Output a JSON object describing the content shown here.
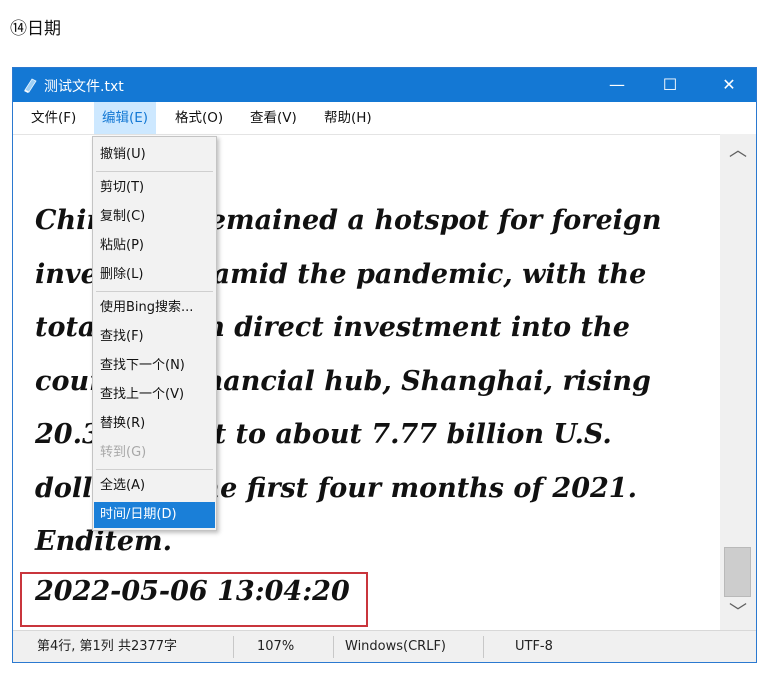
{
  "caption": "⑭日期",
  "window": {
    "title": "测试文件.txt",
    "controls": {
      "minimize": "—",
      "maximize": "☐",
      "close": "✕"
    }
  },
  "menubar": {
    "items": [
      {
        "label": "文件(F)"
      },
      {
        "label": "编辑(E)",
        "active": true
      },
      {
        "label": "格式(O)"
      },
      {
        "label": "查看(V)"
      },
      {
        "label": "帮助(H)"
      }
    ]
  },
  "edit_menu": {
    "undo": "撤销(U)",
    "cut": "剪切(T)",
    "copy": "复制(C)",
    "paste": "粘贴(P)",
    "delete": "删除(L)",
    "bing_search": "使用Bing搜索...",
    "find": "查找(F)",
    "find_next": "查找下一个(N)",
    "find_prev": "查找上一个(V)",
    "replace": "替换(R)",
    "goto": "转到(G)",
    "select_all": "全选(A)",
    "time_date": "时间/日期(D)"
  },
  "editor": {
    "lines": [
      "China has remained a hotspot for foreign",
      "investment amid the pandemic, with the",
      "total foreign direct investment into the",
      "country's financial hub, Shanghai, rising",
      "20.3 percent to about 7.77 billion U.S.",
      "dollars in the first four months of 2021.",
      "Enditem."
    ],
    "inserted_datetime": "2022-05-06 13:04:20"
  },
  "statusbar": {
    "position": "第4行, 第1列 共2377字",
    "zoom": "107%",
    "line_ending": "Windows(CRLF)",
    "encoding": "UTF-8"
  },
  "colors": {
    "titlebar": "#1478d4",
    "menu_selected": "#1a7fd8",
    "highlight_border": "#c9353c"
  }
}
